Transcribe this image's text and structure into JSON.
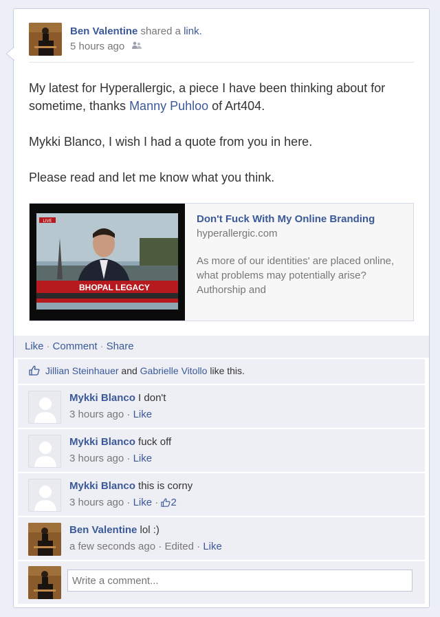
{
  "post": {
    "author": "Ben Valentine",
    "action_text": "shared a",
    "action_link": "link.",
    "timestamp": "5 hours ago",
    "audience_icon": "friends-icon",
    "paragraphs": {
      "p1_before": "My latest for Hyperallergic, a piece I have been thinking about for sometime, thanks ",
      "p1_link": "Manny Puhloo",
      "p1_after": " of Art404.",
      "p2": "Mykki Blanco, I wish I had a quote from you in here.",
      "p3": "Please read and let me know what you think."
    }
  },
  "attachment": {
    "title": "Don't Fuck With My Online Branding",
    "domain": "hyperallergic.com",
    "description": "As more of our identities' are placed online, what problems may potentially arise? Authorship and",
    "thumb_banner": "BHOPAL LEGACY",
    "thumb_live": "LIVE"
  },
  "actions": {
    "like": "Like",
    "comment": "Comment",
    "share": "Share",
    "separator": "·"
  },
  "likes": {
    "person1": "Jillian Steinhauer",
    "and": "and",
    "person2": "Gabrielle Vitollo",
    "suffix": "like this."
  },
  "comments": [
    {
      "author": "Mykki Blanco",
      "text": "I don't",
      "time": "3 hours ago",
      "like": "Like"
    },
    {
      "author": "Mykki Blanco",
      "text": "fuck off",
      "time": "3 hours ago",
      "like": "Like"
    },
    {
      "author": "Mykki Blanco",
      "text": "this is corny",
      "time": "3 hours ago",
      "like": "Like",
      "like_count": "2"
    },
    {
      "author": "Ben Valentine",
      "text": "lol :)",
      "time": "a few seconds ago",
      "edited": "Edited",
      "like": "Like"
    }
  ],
  "composer": {
    "placeholder": "Write a comment..."
  },
  "colors": {
    "link": "#3b5998",
    "ufi_bg": "#edeff4",
    "page_bg": "#eceff5"
  }
}
